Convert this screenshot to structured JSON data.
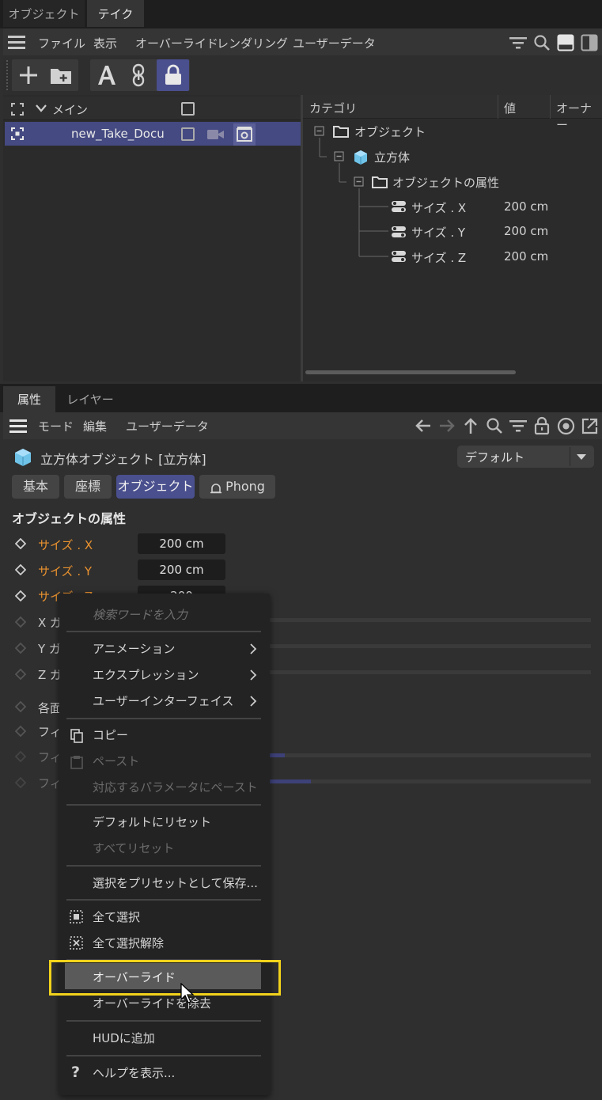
{
  "top_tabs": [
    {
      "label": "オブジェクト",
      "active": false
    },
    {
      "label": "テイク",
      "active": true
    }
  ],
  "take_menu": [
    "ファイル",
    "表示",
    "オーバーライド",
    "レンダリング",
    "ユーザーデータ"
  ],
  "takes": {
    "header_label": "メイン",
    "row_label": "new_Take_Docu"
  },
  "overrides_tree": {
    "columns": [
      "カテゴリ",
      "値",
      "オーナー"
    ],
    "nodes": [
      {
        "label": "オブジェクト",
        "value": ""
      },
      {
        "label": "立方体",
        "value": ""
      },
      {
        "label": "オブジェクトの属性",
        "value": ""
      },
      {
        "label": "サイズ . X",
        "value": "200 cm"
      },
      {
        "label": "サイズ . Y",
        "value": "200 cm"
      },
      {
        "label": "サイズ . Z",
        "value": "200 cm"
      }
    ]
  },
  "attr_tabs": [
    {
      "label": "属性",
      "active": true
    },
    {
      "label": "レイヤー",
      "active": false
    }
  ],
  "attr_menu": [
    "モード",
    "編集",
    "ユーザーデータ"
  ],
  "object_title": "立方体オブジェクト [立方体]",
  "preset_dropdown": "デフォルト",
  "page_tabs": [
    {
      "label": "基本",
      "active": false
    },
    {
      "label": "座標",
      "active": false
    },
    {
      "label": "オブジェクト",
      "active": true
    },
    {
      "label": "Phong",
      "active": false
    }
  ],
  "section_title": "オブジェクトの属性",
  "properties": [
    {
      "label": "サイズ . X",
      "value": "200 cm"
    },
    {
      "label": "サイズ . Y",
      "value": "200 cm"
    },
    {
      "label": "サイズ . Z",
      "value": "200"
    },
    {
      "label": "X ガ"
    },
    {
      "label": "Y ガ"
    },
    {
      "label": "Z ガ"
    },
    {
      "label": "各面"
    },
    {
      "label": "フィ"
    },
    {
      "label": "フィ"
    },
    {
      "label": "フィ"
    }
  ],
  "context_menu": {
    "search_placeholder": "検索ワードを入力",
    "items": {
      "animation": "アニメーション",
      "expression": "エクスプレッション",
      "user_interface": "ユーザーインターフェイス",
      "copy": "コピー",
      "paste": "ペースト",
      "paste_matching": "対応するパラメータにペースト",
      "reset_default": "デフォルトにリセット",
      "reset_all": "すべてリセット",
      "save_preset": "選択をプリセットとして保存...",
      "select_all": "全て選択",
      "deselect_all": "全て選択解除",
      "override": "オーバーライド",
      "remove_override": "オーバーライドを除去",
      "add_hud": "HUDに追加",
      "show_help": "ヘルプを表示..."
    }
  },
  "colors": {
    "accent": "#4a4f8e",
    "highlight_box": "#f2d31b",
    "property_orange": "#e8912f",
    "cube_blue": "#6fc3e8"
  }
}
